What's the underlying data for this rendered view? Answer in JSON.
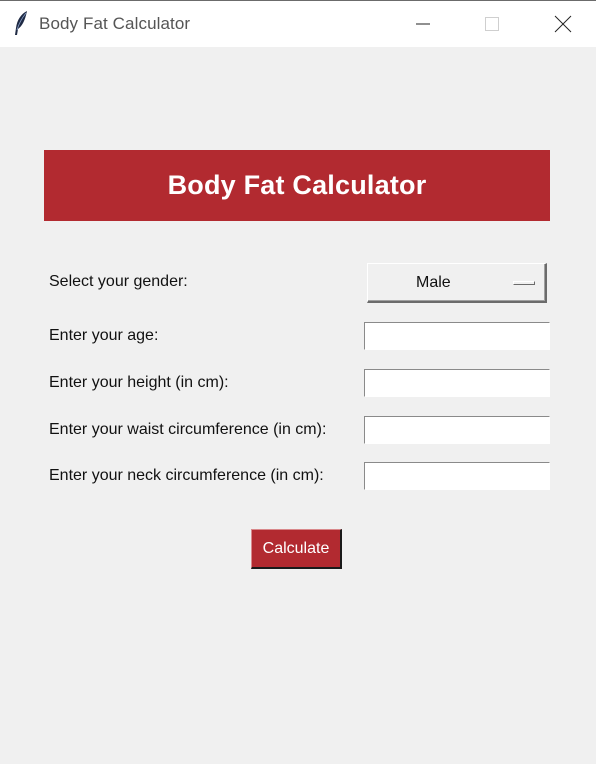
{
  "window": {
    "title": "Body Fat Calculator",
    "icon": "feather-icon"
  },
  "header": {
    "title": "Body Fat Calculator",
    "background_color": "#b22a30",
    "text_color": "#ffffff"
  },
  "form": {
    "gender": {
      "label": "Select your gender:",
      "selected": "Male"
    },
    "age": {
      "label": "Enter your age:",
      "value": ""
    },
    "height": {
      "label": "Enter your height (in cm):",
      "value": ""
    },
    "waist": {
      "label": "Enter your waist circumference (in cm):",
      "value": ""
    },
    "neck": {
      "label": "Enter your neck circumference (in cm):",
      "value": ""
    }
  },
  "actions": {
    "calculate_label": "Calculate",
    "button_color": "#b22a30"
  }
}
